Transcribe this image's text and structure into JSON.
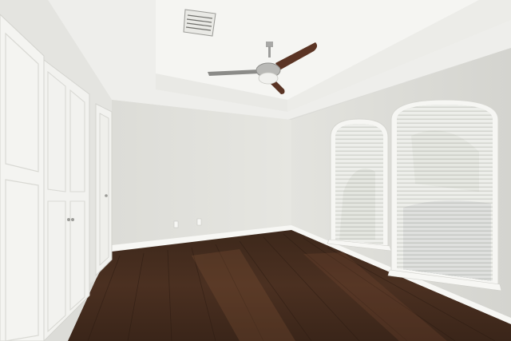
{
  "scene": {
    "description_visible_text": "",
    "palette": {
      "ceiling": "#efefec",
      "tray": "#f4f4f1",
      "wall_back": "#e2e2dd",
      "wall_right": "#dededa",
      "wall_left": "#e6e6e2",
      "floor_dark": "#2f1f16",
      "floor_mid": "#4a3020",
      "floor_light": "#6a4630",
      "trim": "#f7f7f4",
      "door": "#f3f3f0",
      "blind": "#f6f6f3",
      "fan_blade": "#5a3424",
      "fan_metal": "#a7a7a5",
      "vent": "#8c8c88"
    },
    "objects": [
      "ceiling-fan",
      "air-vent",
      "closet-doors",
      "interior-door",
      "arched-window-left",
      "arched-window-right",
      "hardwood-floor",
      "electrical-outlets"
    ]
  }
}
